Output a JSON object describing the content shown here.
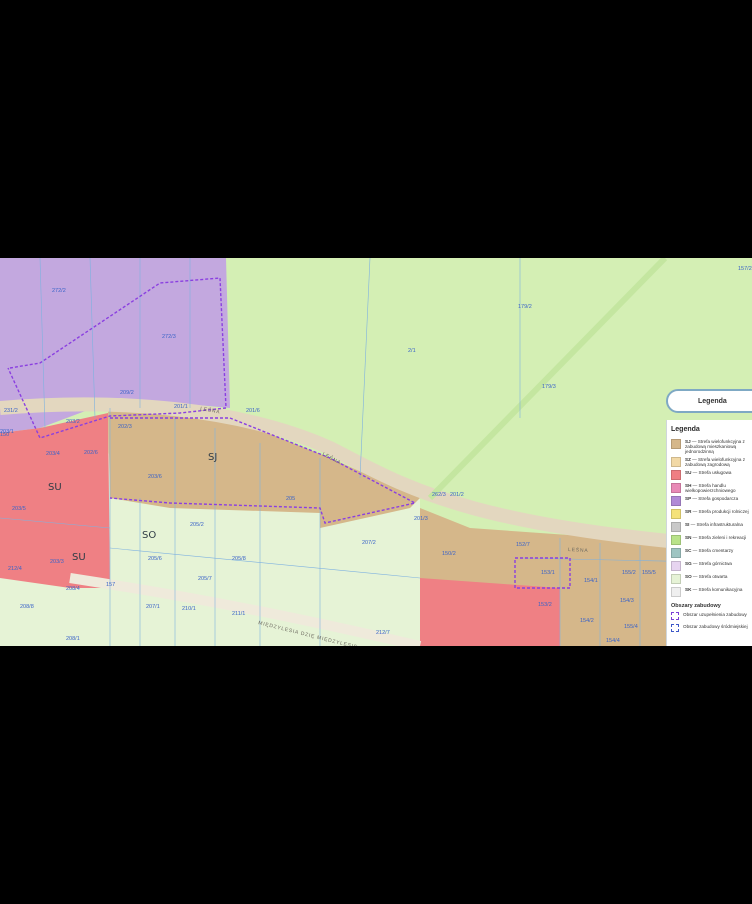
{
  "map": {
    "zones": [
      {
        "code": "SJ"
      },
      {
        "code": "SU"
      },
      {
        "code": "SU"
      },
      {
        "code": "SO"
      }
    ],
    "streets": [
      "LEŚNA",
      "LEŚNA",
      "LEŚNA",
      "MIĘDZYLESIA DZIĘ MIĘDZYLESIE"
    ],
    "parcels": [
      "272/2",
      "272/3",
      "2/1",
      "202/3",
      "201/1",
      "209/2",
      "201/6",
      "202/6",
      "203/4",
      "203/5",
      "203/3",
      "203/2",
      "203/1",
      "203/6",
      "205",
      "205/2",
      "205/6",
      "205/8",
      "205/7",
      "210/1",
      "211/1",
      "207/1",
      "207/2",
      "212/7",
      "208/4",
      "212/4",
      "208/8",
      "208/1",
      "179/2",
      "179/3",
      "201/2",
      "150/2",
      "152/7",
      "153/1",
      "153/2",
      "154/1",
      "154/3",
      "155/2",
      "155/5",
      "155/4",
      "154/2",
      "154/4",
      "157/2",
      "231/2",
      "201/3",
      "262/3",
      "157",
      "150"
    ]
  },
  "legend_button": {
    "label": "Legenda"
  },
  "legend": {
    "title": "Legenda",
    "items": [
      {
        "code": "SJ",
        "label": "— Strefa wielofunkcyjna z zabudową mieszkaniową jednorodzinną",
        "color": "#d5b78a"
      },
      {
        "code": "SZ",
        "label": "— Strefa wielofunkcyjna z zabudową zagrodową",
        "color": "#f2d9a6"
      },
      {
        "code": "SU",
        "label": "— Strefa usługowa",
        "color": "#ef7f83"
      },
      {
        "code": "SH",
        "label": "— Strefa handlu wielkopowierzchniowego",
        "color": "#e889b6"
      },
      {
        "code": "SP",
        "label": "— Strefa gospodarcza",
        "color": "#b08ad6"
      },
      {
        "code": "SR",
        "label": "— Strefa produkcji rolniczej",
        "color": "#f5e27a"
      },
      {
        "code": "SI",
        "label": "— Strefa infrastrukturalna",
        "color": "#c9c9c9"
      },
      {
        "code": "SN",
        "label": "— Strefa zieleni i rekreacji",
        "color": "#b9e38a"
      },
      {
        "code": "SC",
        "label": "— Strefa cmentarzy",
        "color": "#9fc5c2"
      },
      {
        "code": "SG",
        "label": "— Strefa górnictwa",
        "color": "#e7d4f0"
      },
      {
        "code": "SO",
        "label": "— Strefa otwarta",
        "color": "#e6f3d6"
      },
      {
        "code": "SK",
        "label": "— Strefa komunikacyjna",
        "color": "#efefef"
      }
    ],
    "areas_title": "Obszary zabudowy",
    "areas": [
      {
        "label": "Obszar uzupełnienia zabudowy"
      },
      {
        "label": "Obszar zabudowy śródmiejskiej"
      }
    ]
  }
}
